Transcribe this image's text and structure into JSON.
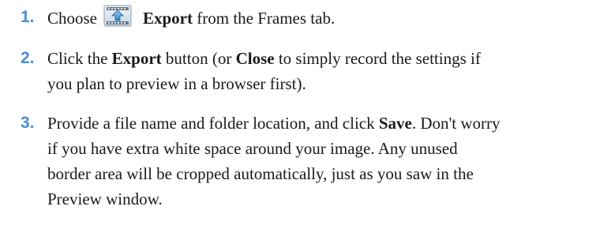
{
  "steps": [
    {
      "number": "1.",
      "pre": "Choose",
      "bold": "Export",
      "post": " from the Frames tab.",
      "icon": "export-film-icon"
    },
    {
      "number": "2.",
      "t1": "Click the ",
      "b1": "Export",
      "t2": " button (or ",
      "b2": "Close",
      "t3": " to simply record the settings if",
      "t4": "you plan to preview in a browser first)."
    },
    {
      "number": "3.",
      "t1": "Provide a file name and folder location, and click ",
      "b1": "Save",
      "t2": ". Don't worry",
      "l2": "if you have extra white space around your image. Any unused",
      "l3": "border area will be cropped automatically, just as you saw in the",
      "l4": "Preview window."
    }
  ],
  "colors": {
    "accent": "#4a8fd4",
    "text": "#1a1a1a"
  }
}
